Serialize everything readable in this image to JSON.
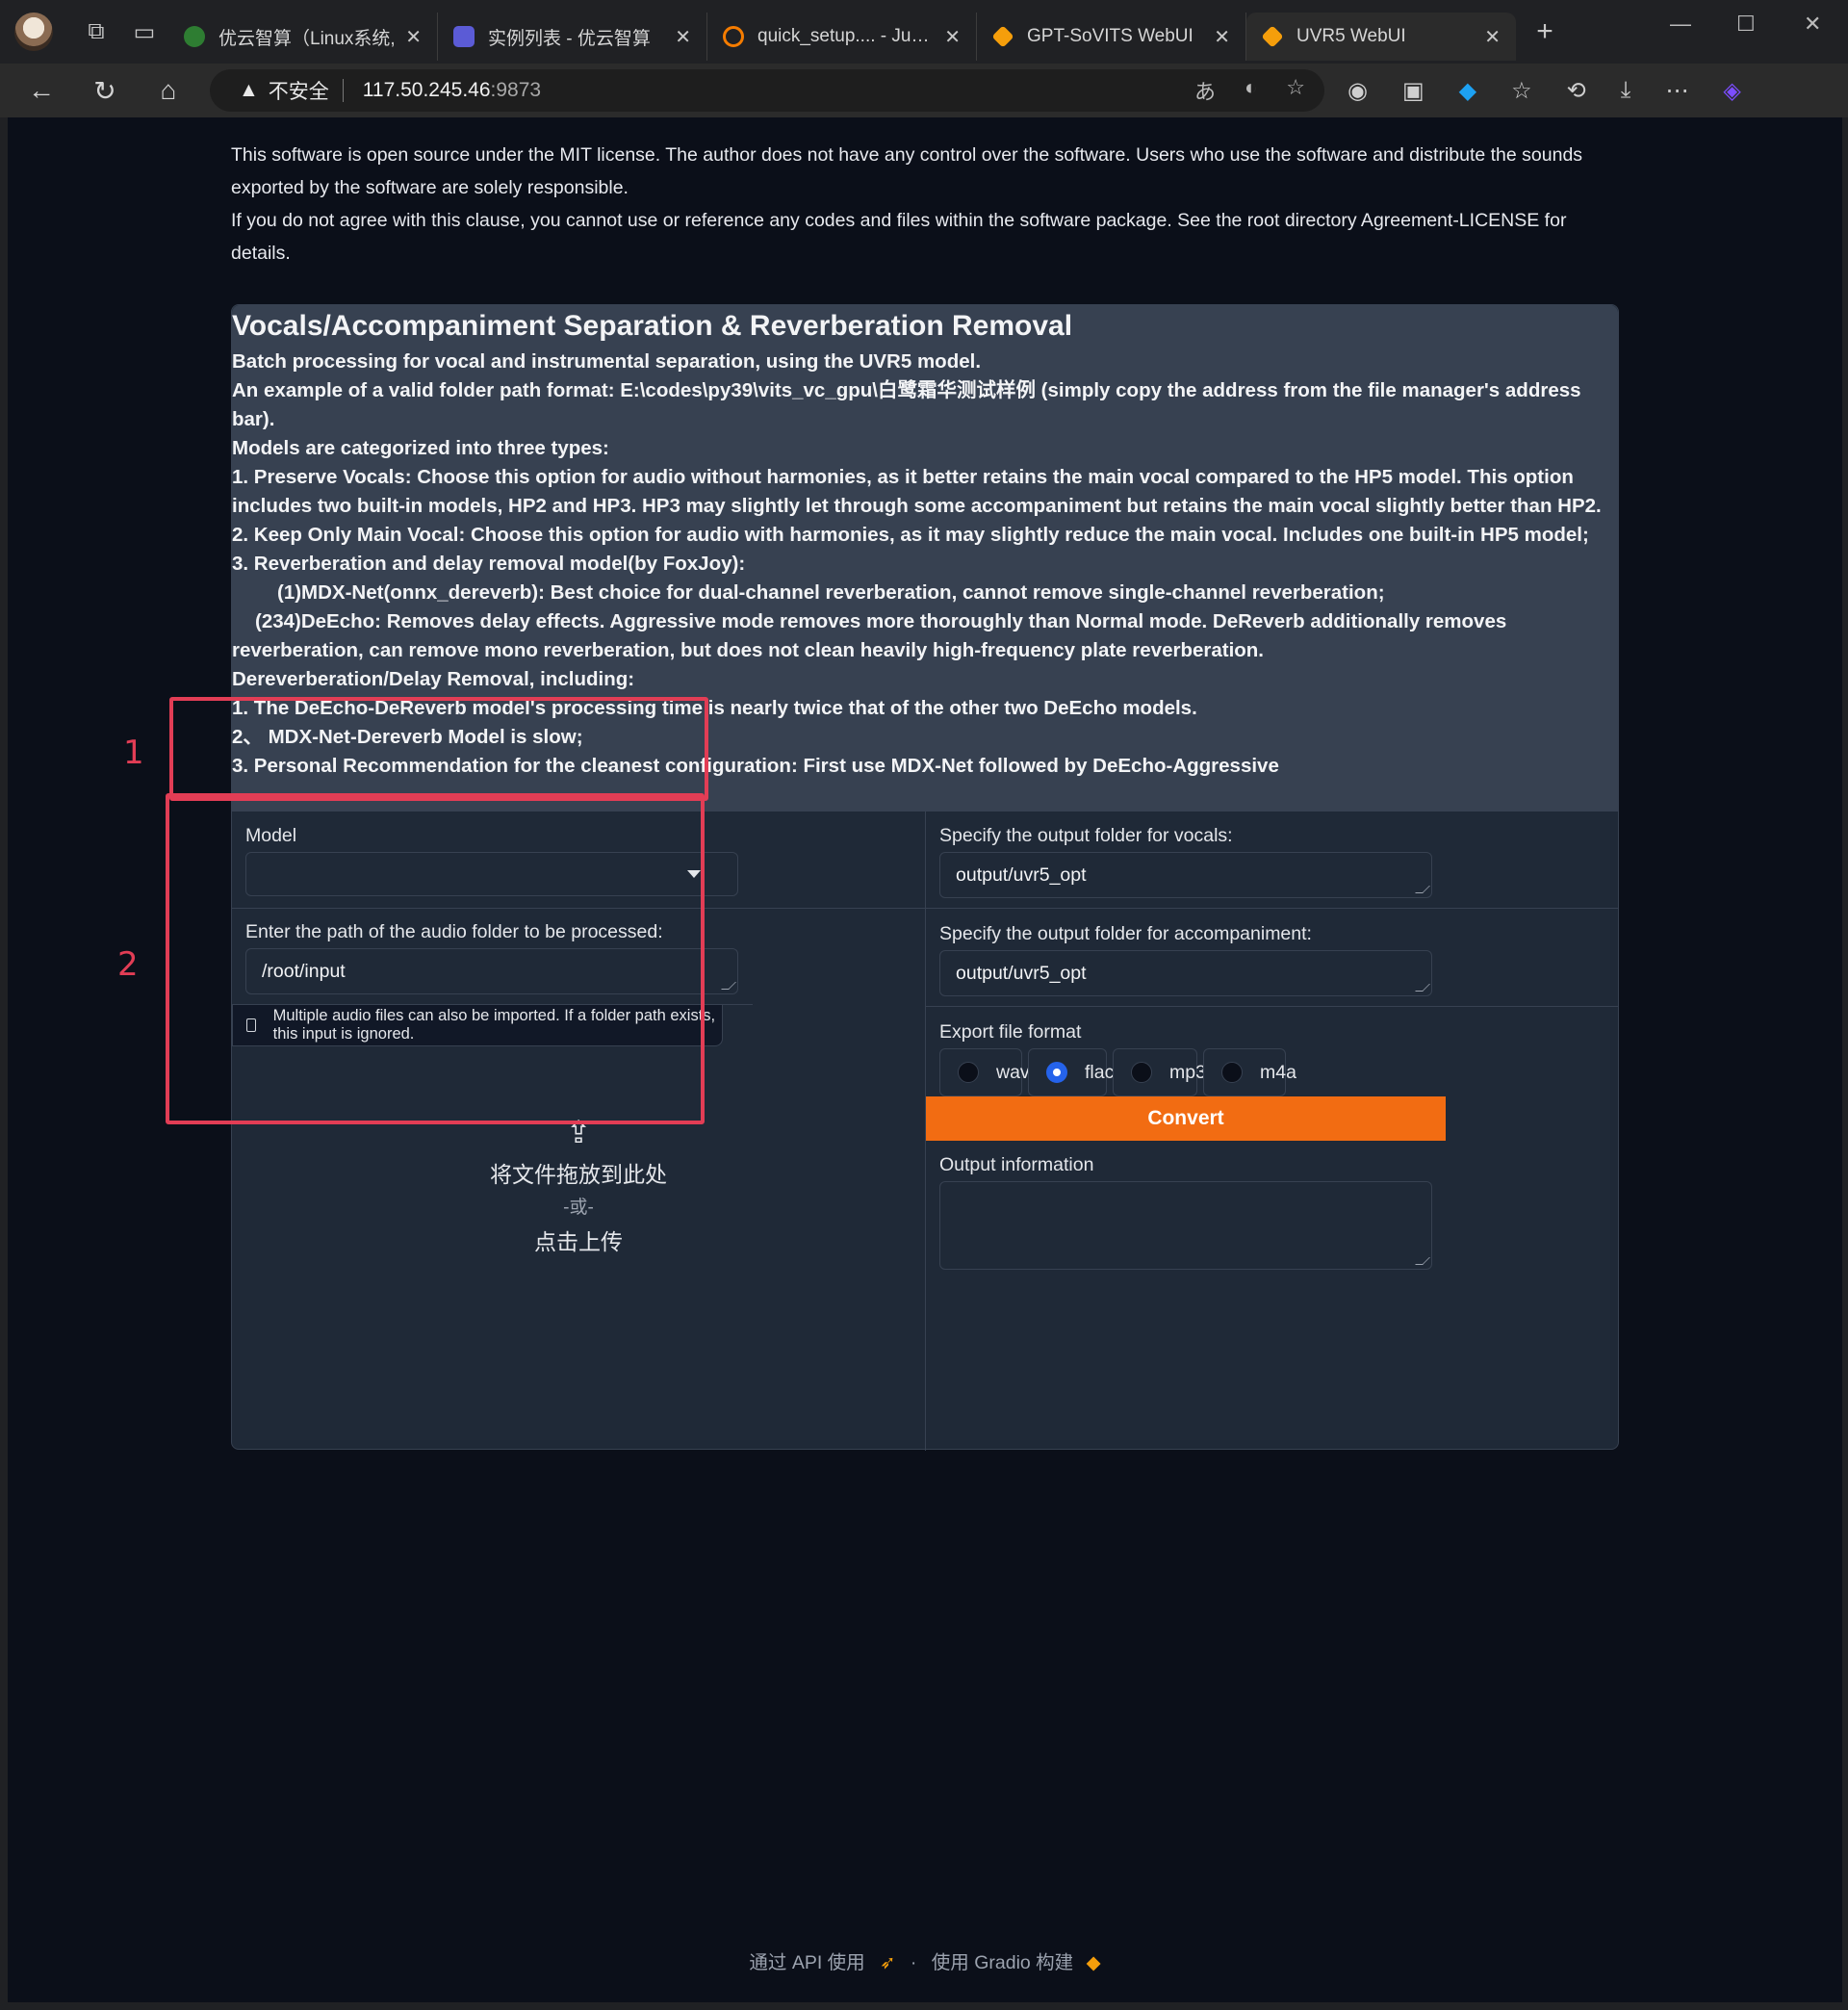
{
  "browser": {
    "tabs": [
      {
        "title": "优云智算（Linux系统,",
        "favicon_color": "#2e7d32",
        "active": false
      },
      {
        "title": "实例列表 - 优云智算",
        "favicon_color": "#5b5bd6",
        "active": false
      },
      {
        "title": "quick_setup.... - Jupyter",
        "favicon_color": "#f57c00",
        "active": false
      },
      {
        "title": "GPT-SoVITS WebUI",
        "favicon_color": "#f59e0b",
        "active": false
      },
      {
        "title": "UVR5 WebUI",
        "favicon_color": "#f59e0b",
        "active": true
      }
    ],
    "address": {
      "insecure_label": "不安全",
      "host": "117.50.245.46",
      "port": ":9873"
    }
  },
  "notice": {
    "line1": "This software is open source under the MIT license. The author does not have any control over the software. Users who use the software and distribute the sounds exported by the software are solely responsible.",
    "line2": "If you do not agree with this clause, you cannot use or reference any codes and files within the software package. See the root directory Agreement-LICENSE for details."
  },
  "description": {
    "title": "Vocals/Accompaniment Separation & Reverberation Removal",
    "lines": [
      "Batch processing for vocal and instrumental separation, using the UVR5 model.",
      "An example of a valid folder path format: E:\\codes\\py39\\vits_vc_gpu\\白鹭霜华测试样例 (simply copy the address from the file manager's address bar).",
      "Models are categorized into three types:",
      "1. Preserve Vocals: Choose this option for audio without harmonies, as it better retains the main vocal compared to the HP5 model. This option includes two built-in models, HP2 and HP3. HP3 may slightly let through some accompaniment but retains the main vocal slightly better than HP2.",
      "2. Keep Only Main Vocal: Choose this option for audio with harmonies, as it may slightly reduce the main vocal. Includes one built-in HP5 model;",
      "3. Reverberation and delay removal model(by FoxJoy):"
    ],
    "sub1": "(1)MDX-Net(onnx_dereverb): Best choice for dual-channel reverberation, cannot remove single-channel reverberation;",
    "sub2": "(234)DeEcho: Removes delay effects. Aggressive mode removes more thoroughly than Normal mode. DeReverb additionally removes reverberation, can remove mono reverberation, but does not clean heavily high-frequency plate reverberation.",
    "lines2": [
      "Dereverberation/Delay Removal, including:",
      "1. The DeEcho-DeReverb model's processing time is nearly twice that of the other two DeEcho models.",
      "2、 MDX-Net-Dereverb Model is slow;",
      "3. Personal Recommendation for the cleanest configuration: First use MDX-Net followed by DeEcho-Aggressive"
    ]
  },
  "form": {
    "model_label": "Model",
    "model_value": "",
    "input_folder_label": "Enter the path of the audio folder to be processed:",
    "input_folder_value": "/root/input",
    "upload_tag": "Multiple audio files can also be imported. If a folder path exists, this input is ignored.",
    "upload_drop": "将文件拖放到此处",
    "upload_or": "-或-",
    "upload_click": "点击上传",
    "vocal_out_label": "Specify the output folder for vocals:",
    "vocal_out_value": "output/uvr5_opt",
    "acc_out_label": "Specify the output folder for accompaniment:",
    "acc_out_value": "output/uvr5_opt",
    "format_label": "Export file format",
    "formats": [
      "wav",
      "flac",
      "mp3",
      "m4a"
    ],
    "format_selected": "flac",
    "convert_label": "Convert",
    "output_label": "Output information",
    "output_value": ""
  },
  "annotations": {
    "box1": "1",
    "box2": "2"
  },
  "footer": {
    "api": "通过 API 使用",
    "dot": "·",
    "built": "使用 Gradio 构建"
  },
  "colors": {
    "accent": "#f26c12",
    "annotation": "#e23d55",
    "radio_checked": "#2563eb"
  }
}
